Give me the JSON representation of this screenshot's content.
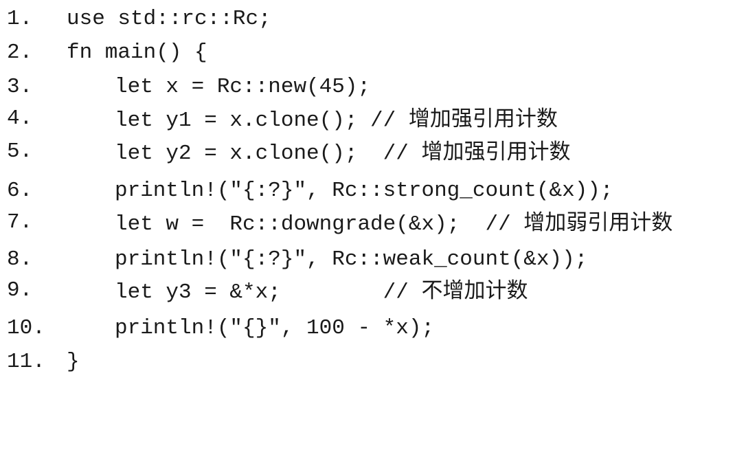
{
  "lines": [
    {
      "num": "1.",
      "code": "use std::rc::Rc;",
      "comment": ""
    },
    {
      "num": "2.",
      "code": "fn main() {",
      "comment": ""
    },
    {
      "num": "3.",
      "code": "let x = Rc::new(45);",
      "comment": ""
    },
    {
      "num": "4.",
      "code": "let y1 = x.clone(); // ",
      "comment": "增加强引用计数"
    },
    {
      "num": "5.",
      "code": "let y2 = x.clone();  // ",
      "comment": "增加强引用计数"
    },
    {
      "num": "6.",
      "code": "println!(\"{:?}\", Rc::strong_count(&x));",
      "comment": ""
    },
    {
      "num": "7.",
      "code": "let w =  Rc::downgrade(&x);  // ",
      "comment": "增加弱引用计数"
    },
    {
      "num": "8.",
      "code": "println!(\"{:?}\", Rc::weak_count(&x));",
      "comment": ""
    },
    {
      "num": "9.",
      "code": "let y3 = &*x;        // ",
      "comment": "不增加计数"
    },
    {
      "num": "10.",
      "code": "println!(\"{}\", 100 - *x);",
      "comment": ""
    },
    {
      "num": "11.",
      "code": "}",
      "comment": ""
    }
  ]
}
